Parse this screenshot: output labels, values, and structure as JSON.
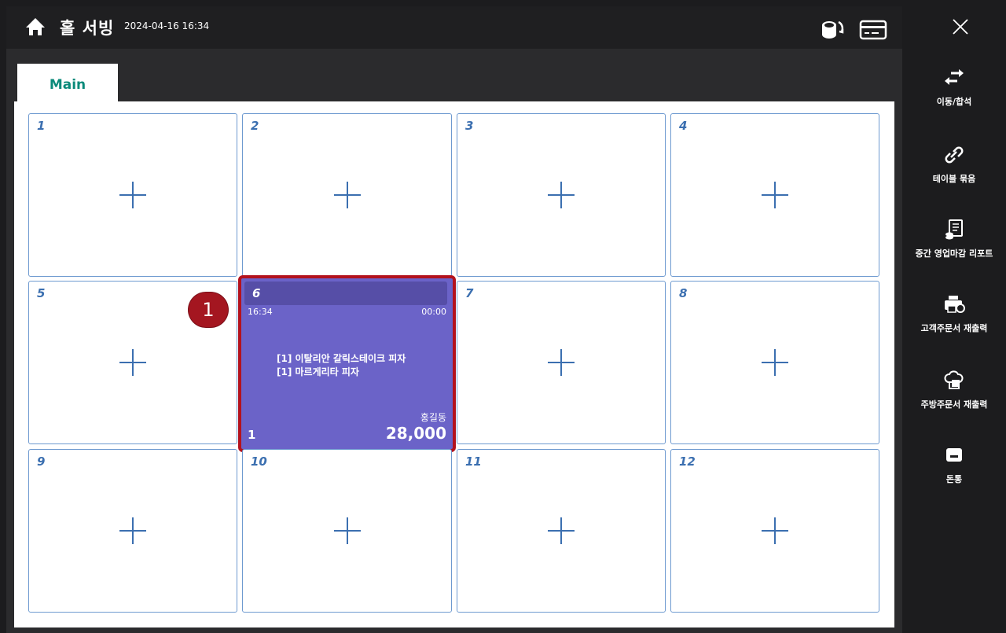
{
  "header": {
    "title": "홀 서빙",
    "datetime": "2024-04-16 16:34",
    "icons": [
      "home-icon",
      "coin-exchange-icon",
      "card-icon"
    ]
  },
  "tabs": [
    {
      "label": "Main",
      "active": true
    }
  ],
  "tables": [
    {
      "number": "1"
    },
    {
      "number": "2"
    },
    {
      "number": "3"
    },
    {
      "number": "4"
    },
    {
      "number": "5"
    },
    {
      "number": "6"
    },
    {
      "number": "7"
    },
    {
      "number": "8"
    },
    {
      "number": "9"
    },
    {
      "number": "10"
    },
    {
      "number": "11"
    },
    {
      "number": "12"
    }
  ],
  "active_table": {
    "number": "6",
    "start_time": "16:34",
    "elapsed": "00:00",
    "orders": [
      "[1] 이탈리안 갈릭스테이크 피자",
      "[1] 마르게리타 피자"
    ],
    "customer": "홍길동",
    "guests": "1",
    "total": "28,000",
    "bg_color": "#6b63c8",
    "highlight_color": "#b3121d"
  },
  "badge": {
    "label": "1"
  },
  "sidebar": {
    "items": [
      {
        "label": "이동/합석",
        "icon": "move-arrows-icon"
      },
      {
        "label": "테이블 묶음",
        "icon": "link-icon"
      },
      {
        "label": "중간 영업마감 리포트",
        "icon": "report-icon"
      },
      {
        "label": "고객주문서 재출력",
        "icon": "printer-reprint-icon"
      },
      {
        "label": "주방주문서 재출력",
        "icon": "chef-hat-icon"
      },
      {
        "label": "돈통",
        "icon": "cash-drawer-icon"
      }
    ]
  }
}
